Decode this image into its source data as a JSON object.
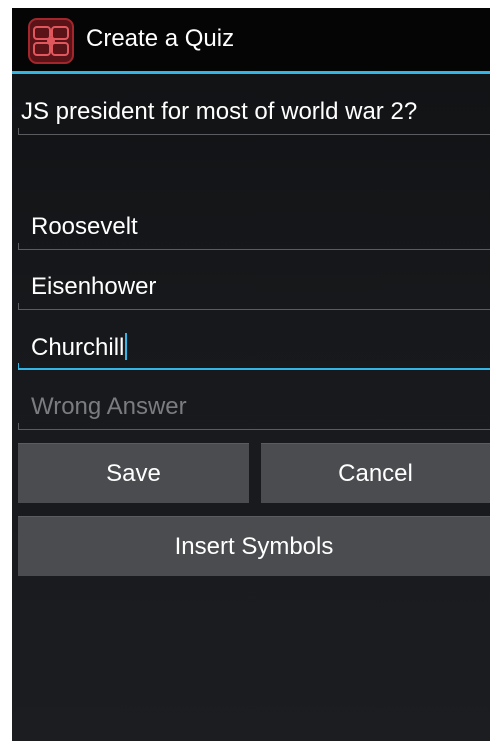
{
  "app": {
    "title": "Create a Quiz",
    "icon": "quiz-app-logo-icon"
  },
  "form": {
    "question_value": "JS president for most of world war 2?",
    "answer_fields": [
      {
        "value": "Roosevelt",
        "placeholder": ""
      },
      {
        "value": "Eisenhower",
        "placeholder": ""
      },
      {
        "value": "Churchill",
        "placeholder": ""
      },
      {
        "value": "",
        "placeholder": "Wrong Answer"
      }
    ]
  },
  "buttons": {
    "save": "Save",
    "cancel": "Cancel",
    "insert_symbols": "Insert Symbols"
  },
  "colors": {
    "accent": "#33b5e5",
    "button_bg": "#4a4c4f",
    "hint_text": "#7a7c7f"
  }
}
